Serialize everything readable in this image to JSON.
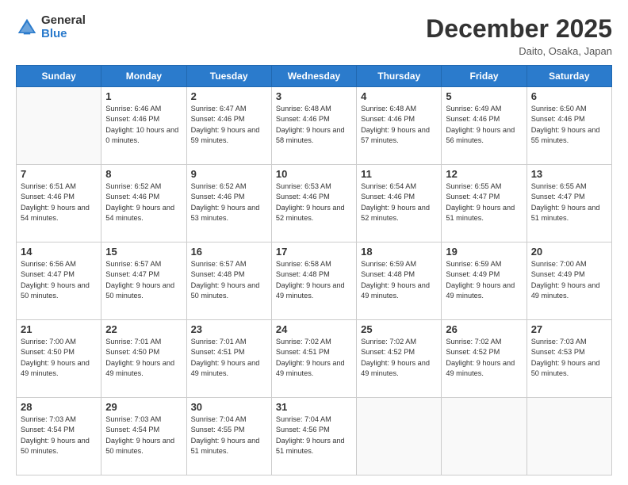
{
  "header": {
    "logo_general": "General",
    "logo_blue": "Blue",
    "month_title": "December 2025",
    "location": "Daito, Osaka, Japan"
  },
  "days_of_week": [
    "Sunday",
    "Monday",
    "Tuesday",
    "Wednesday",
    "Thursday",
    "Friday",
    "Saturday"
  ],
  "weeks": [
    [
      {
        "day": "",
        "sunrise": "",
        "sunset": "",
        "daylight": ""
      },
      {
        "day": "1",
        "sunrise": "Sunrise: 6:46 AM",
        "sunset": "Sunset: 4:46 PM",
        "daylight": "Daylight: 10 hours and 0 minutes."
      },
      {
        "day": "2",
        "sunrise": "Sunrise: 6:47 AM",
        "sunset": "Sunset: 4:46 PM",
        "daylight": "Daylight: 9 hours and 59 minutes."
      },
      {
        "day": "3",
        "sunrise": "Sunrise: 6:48 AM",
        "sunset": "Sunset: 4:46 PM",
        "daylight": "Daylight: 9 hours and 58 minutes."
      },
      {
        "day": "4",
        "sunrise": "Sunrise: 6:48 AM",
        "sunset": "Sunset: 4:46 PM",
        "daylight": "Daylight: 9 hours and 57 minutes."
      },
      {
        "day": "5",
        "sunrise": "Sunrise: 6:49 AM",
        "sunset": "Sunset: 4:46 PM",
        "daylight": "Daylight: 9 hours and 56 minutes."
      },
      {
        "day": "6",
        "sunrise": "Sunrise: 6:50 AM",
        "sunset": "Sunset: 4:46 PM",
        "daylight": "Daylight: 9 hours and 55 minutes."
      }
    ],
    [
      {
        "day": "7",
        "sunrise": "Sunrise: 6:51 AM",
        "sunset": "Sunset: 4:46 PM",
        "daylight": "Daylight: 9 hours and 54 minutes."
      },
      {
        "day": "8",
        "sunrise": "Sunrise: 6:52 AM",
        "sunset": "Sunset: 4:46 PM",
        "daylight": "Daylight: 9 hours and 54 minutes."
      },
      {
        "day": "9",
        "sunrise": "Sunrise: 6:52 AM",
        "sunset": "Sunset: 4:46 PM",
        "daylight": "Daylight: 9 hours and 53 minutes."
      },
      {
        "day": "10",
        "sunrise": "Sunrise: 6:53 AM",
        "sunset": "Sunset: 4:46 PM",
        "daylight": "Daylight: 9 hours and 52 minutes."
      },
      {
        "day": "11",
        "sunrise": "Sunrise: 6:54 AM",
        "sunset": "Sunset: 4:46 PM",
        "daylight": "Daylight: 9 hours and 52 minutes."
      },
      {
        "day": "12",
        "sunrise": "Sunrise: 6:55 AM",
        "sunset": "Sunset: 4:47 PM",
        "daylight": "Daylight: 9 hours and 51 minutes."
      },
      {
        "day": "13",
        "sunrise": "Sunrise: 6:55 AM",
        "sunset": "Sunset: 4:47 PM",
        "daylight": "Daylight: 9 hours and 51 minutes."
      }
    ],
    [
      {
        "day": "14",
        "sunrise": "Sunrise: 6:56 AM",
        "sunset": "Sunset: 4:47 PM",
        "daylight": "Daylight: 9 hours and 50 minutes."
      },
      {
        "day": "15",
        "sunrise": "Sunrise: 6:57 AM",
        "sunset": "Sunset: 4:47 PM",
        "daylight": "Daylight: 9 hours and 50 minutes."
      },
      {
        "day": "16",
        "sunrise": "Sunrise: 6:57 AM",
        "sunset": "Sunset: 4:48 PM",
        "daylight": "Daylight: 9 hours and 50 minutes."
      },
      {
        "day": "17",
        "sunrise": "Sunrise: 6:58 AM",
        "sunset": "Sunset: 4:48 PM",
        "daylight": "Daylight: 9 hours and 49 minutes."
      },
      {
        "day": "18",
        "sunrise": "Sunrise: 6:59 AM",
        "sunset": "Sunset: 4:48 PM",
        "daylight": "Daylight: 9 hours and 49 minutes."
      },
      {
        "day": "19",
        "sunrise": "Sunrise: 6:59 AM",
        "sunset": "Sunset: 4:49 PM",
        "daylight": "Daylight: 9 hours and 49 minutes."
      },
      {
        "day": "20",
        "sunrise": "Sunrise: 7:00 AM",
        "sunset": "Sunset: 4:49 PM",
        "daylight": "Daylight: 9 hours and 49 minutes."
      }
    ],
    [
      {
        "day": "21",
        "sunrise": "Sunrise: 7:00 AM",
        "sunset": "Sunset: 4:50 PM",
        "daylight": "Daylight: 9 hours and 49 minutes."
      },
      {
        "day": "22",
        "sunrise": "Sunrise: 7:01 AM",
        "sunset": "Sunset: 4:50 PM",
        "daylight": "Daylight: 9 hours and 49 minutes."
      },
      {
        "day": "23",
        "sunrise": "Sunrise: 7:01 AM",
        "sunset": "Sunset: 4:51 PM",
        "daylight": "Daylight: 9 hours and 49 minutes."
      },
      {
        "day": "24",
        "sunrise": "Sunrise: 7:02 AM",
        "sunset": "Sunset: 4:51 PM",
        "daylight": "Daylight: 9 hours and 49 minutes."
      },
      {
        "day": "25",
        "sunrise": "Sunrise: 7:02 AM",
        "sunset": "Sunset: 4:52 PM",
        "daylight": "Daylight: 9 hours and 49 minutes."
      },
      {
        "day": "26",
        "sunrise": "Sunrise: 7:02 AM",
        "sunset": "Sunset: 4:52 PM",
        "daylight": "Daylight: 9 hours and 49 minutes."
      },
      {
        "day": "27",
        "sunrise": "Sunrise: 7:03 AM",
        "sunset": "Sunset: 4:53 PM",
        "daylight": "Daylight: 9 hours and 50 minutes."
      }
    ],
    [
      {
        "day": "28",
        "sunrise": "Sunrise: 7:03 AM",
        "sunset": "Sunset: 4:54 PM",
        "daylight": "Daylight: 9 hours and 50 minutes."
      },
      {
        "day": "29",
        "sunrise": "Sunrise: 7:03 AM",
        "sunset": "Sunset: 4:54 PM",
        "daylight": "Daylight: 9 hours and 50 minutes."
      },
      {
        "day": "30",
        "sunrise": "Sunrise: 7:04 AM",
        "sunset": "Sunset: 4:55 PM",
        "daylight": "Daylight: 9 hours and 51 minutes."
      },
      {
        "day": "31",
        "sunrise": "Sunrise: 7:04 AM",
        "sunset": "Sunset: 4:56 PM",
        "daylight": "Daylight: 9 hours and 51 minutes."
      },
      {
        "day": "",
        "sunrise": "",
        "sunset": "",
        "daylight": ""
      },
      {
        "day": "",
        "sunrise": "",
        "sunset": "",
        "daylight": ""
      },
      {
        "day": "",
        "sunrise": "",
        "sunset": "",
        "daylight": ""
      }
    ]
  ]
}
